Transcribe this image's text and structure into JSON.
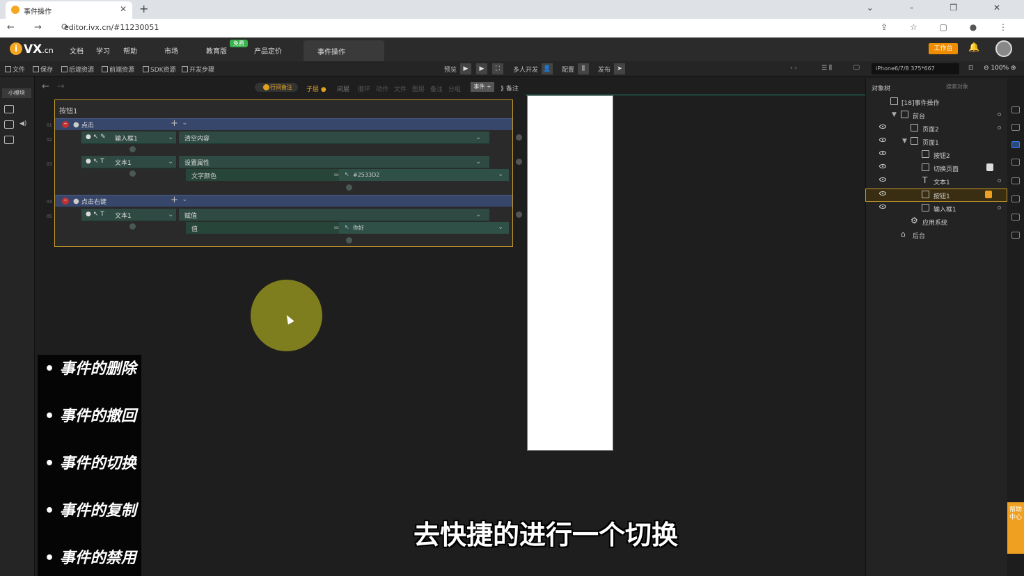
{
  "browser": {
    "tab_title": "事件操作",
    "new_tab": "+",
    "url": "editor.ivx.cn/#11230051"
  },
  "app": {
    "logo": "VX",
    "logo_suffix": ".cn",
    "menu": [
      "文档",
      "学习",
      "帮助",
      "市场",
      "教育版",
      "产品定价"
    ],
    "free_badge": "免费",
    "active_tab": "事件操作",
    "workbench_button": "工作台"
  },
  "toolbar": {
    "left_items": [
      "文件",
      "保存",
      "后端资源",
      "前端资源",
      "SDK资源",
      "开发步骤"
    ],
    "preview": "预览",
    "multi_dev": "多人开发",
    "config": "配置",
    "publish": "发布",
    "device": "iPhone6/7/8 375*667",
    "zoom": "100%"
  },
  "leftbar": {
    "small_module": "小模块"
  },
  "editor": {
    "toolbar": {
      "toggle_label": "行间备注",
      "child_label": "子层",
      "items": [
        "间层",
        "循环",
        "动作",
        "文件",
        "图层",
        "备注",
        "分组"
      ],
      "event_button": "事件",
      "comment": "备注"
    },
    "component_title": "按钮1",
    "events": [
      {
        "trigger": "点击",
        "actions": [
          {
            "target": "输入框1",
            "action": "清空内容",
            "params": []
          },
          {
            "target": "文本1",
            "action": "设置属性",
            "params": [
              {
                "name": "文字颜色",
                "value": "#2533D2"
              }
            ]
          }
        ]
      },
      {
        "trigger": "点击右键",
        "actions": [
          {
            "target": "文本1",
            "action": "赋值",
            "params": [
              {
                "name": "值",
                "value": "你好"
              }
            ]
          }
        ]
      }
    ],
    "line_numbers": [
      "01",
      "02",
      "03",
      "04",
      "05"
    ]
  },
  "topics": [
    "• 事件的删除",
    "• 事件的撤回",
    "• 事件的切换",
    "• 事件的复制",
    "• 事件的禁用"
  ],
  "subtitle": "去快捷的进行一个切换",
  "right_panel": {
    "title": "对象树",
    "search_placeholder": "搜索对象",
    "tree": [
      {
        "label": "[18]事件操作",
        "level": 0
      },
      {
        "label": "前台",
        "level": 1
      },
      {
        "label": "页面2",
        "level": 2
      },
      {
        "label": "页面1",
        "level": 2
      },
      {
        "label": "按钮2",
        "level": 3
      },
      {
        "label": "切换页面",
        "level": 3
      },
      {
        "label": "文本1",
        "level": 3
      },
      {
        "label": "按钮1",
        "level": 3,
        "selected": true
      },
      {
        "label": "输入框1",
        "level": 3
      },
      {
        "label": "应用系统",
        "level": 2
      },
      {
        "label": "后台",
        "level": 1
      }
    ]
  },
  "help_tab": "帮助中心",
  "colors": {
    "accent": "#c99b2c",
    "event_row": "#37476b",
    "action_row": "#26463c",
    "workbench": "#f08c00"
  }
}
